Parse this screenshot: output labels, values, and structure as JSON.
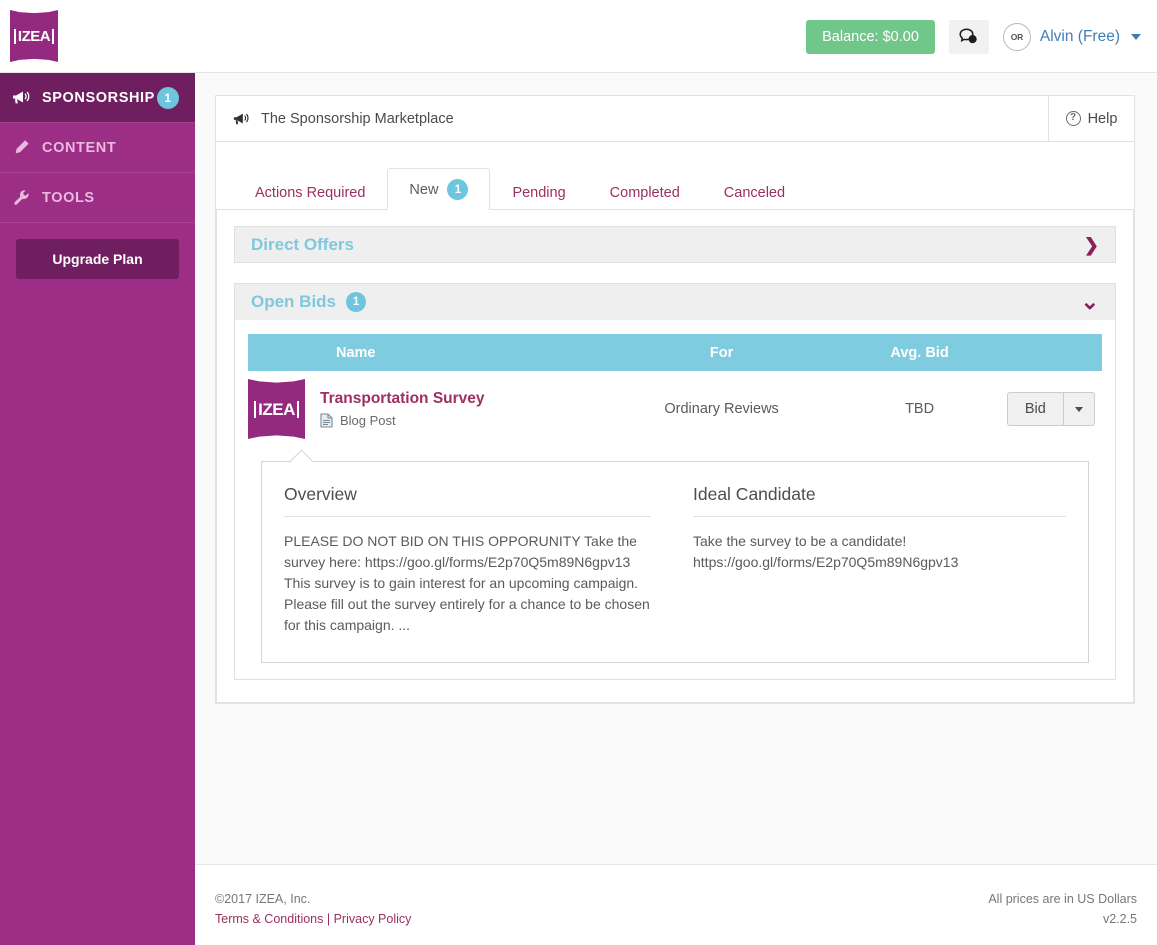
{
  "brand": {
    "logo_text": "IZEA",
    "accent_purple": "#9c2f85",
    "accent_dark_purple": "#6f1f60",
    "accent_teal": "#6ec6de",
    "accent_green": "#71c68a",
    "link_pink": "#9c3060"
  },
  "topbar": {
    "balance_label": "Balance: $0.00",
    "messages_icon": "chat-bubble-icon",
    "avatar_text": "OR",
    "user_label": "Alvin (Free)",
    "user_caret_icon": "chevron-down-icon"
  },
  "sidebar": {
    "items": [
      {
        "label": "SPONSORSHIP",
        "icon": "megaphone-icon",
        "badge": "1",
        "active": true
      },
      {
        "label": "CONTENT",
        "icon": "pencil-icon",
        "badge": "",
        "active": false
      },
      {
        "label": "TOOLS",
        "icon": "wrench-icon",
        "badge": "",
        "active": false
      }
    ],
    "upgrade_label": "Upgrade Plan"
  },
  "marketplace_bar": {
    "icon": "megaphone-icon",
    "title": "The Sponsorship Marketplace",
    "help_label": "Help",
    "help_icon": "question-circle-icon"
  },
  "tabs": [
    {
      "label": "Actions Required",
      "badge": "",
      "active": false
    },
    {
      "label": "New",
      "badge": "1",
      "active": true
    },
    {
      "label": "Pending",
      "badge": "",
      "active": false
    },
    {
      "label": "Completed",
      "badge": "",
      "active": false
    },
    {
      "label": "Canceled",
      "badge": "",
      "active": false
    }
  ],
  "direct_offers": {
    "title": "Direct Offers",
    "badge": "",
    "arrow_icon": "chevron-right-icon",
    "arrow_glyph": "❯",
    "expanded": false
  },
  "open_bids": {
    "title": "Open Bids",
    "badge": "1",
    "arrow_icon": "chevron-down-icon",
    "arrow_glyph": "⌄",
    "expanded": true,
    "columns": [
      "Name",
      "For",
      "Avg. Bid",
      ""
    ],
    "rows": [
      {
        "thumbnail": "izea-logo-thumbnail",
        "name": "Transportation Survey",
        "type_icon": "document-icon",
        "type": "Blog Post",
        "for": "Ordinary Reviews",
        "avg_bid": "TBD",
        "bid_button": "Bid",
        "bid_caret_icon": "caret-down-icon"
      }
    ],
    "detail": {
      "overview_heading": "Overview",
      "overview_text": "PLEASE DO NOT BID ON THIS OPPORUNITY Take the survey here: https://goo.gl/forms/E2p70Q5m89N6gpv13 This survey is to gain interest for an upcoming campaign. Please fill out the survey entirely for a chance to be chosen for this campaign. ...",
      "candidate_heading": "Ideal Candidate",
      "candidate_text": "Take the survey to be a candidate! https://goo.gl/forms/E2p70Q5m89N6gpv13"
    }
  },
  "footer": {
    "copyright": "©2017 IZEA, Inc.",
    "terms_label": "Terms & Conditions",
    "separator": "|",
    "privacy_label": "Privacy Policy",
    "currency_note": "All prices are in US Dollars",
    "version": "v2.2.5"
  }
}
